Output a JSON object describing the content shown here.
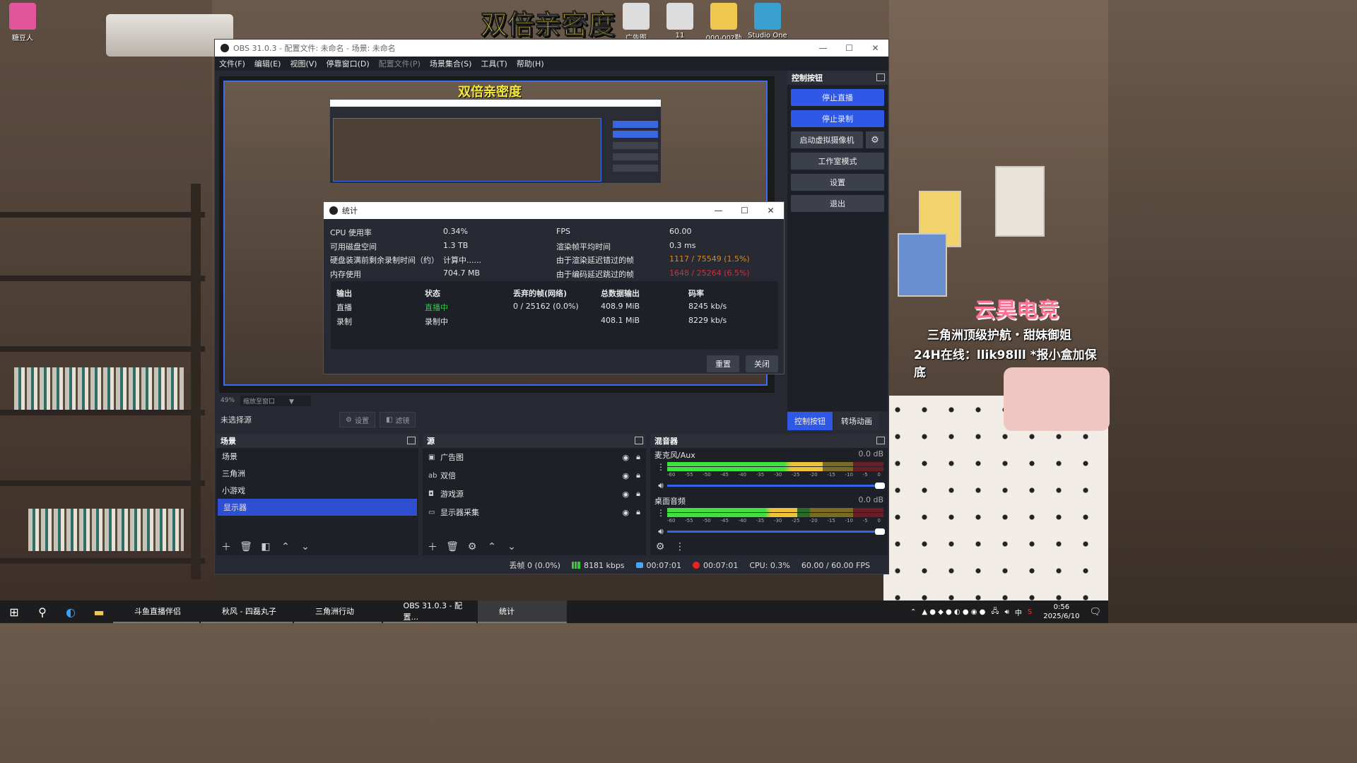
{
  "overlay": {
    "title": "双倍亲密度",
    "brand": "云昊电竞",
    "line1": "三角洲顶级护航・甜妹御姐",
    "line2": "24H在线：llik98lll *报小盒加保底"
  },
  "desktop_icons": [
    {
      "label": "糖豆人",
      "color": "#e0559c"
    },
    {
      "label": "广告图",
      "color": "#ddd"
    },
    {
      "label": "11",
      "color": "#ddd"
    },
    {
      "label": "000-00?勤能",
      "color": "#f0c850"
    },
    {
      "label": "Studio One",
      "color": "#3aa0d0"
    }
  ],
  "obs": {
    "title": "OBS 31.0.3 - 配置文件: 未命名 - 场景: 未命名",
    "menu": [
      "文件(F)",
      "编辑(E)",
      "视图(V)",
      "停靠窗口(D)",
      "配置文件(P)",
      "场景集合(S)",
      "工具(T)",
      "帮助(H)"
    ],
    "zoom": "49%",
    "zoom_mode": "缩放至窗口",
    "no_source": "未选择源",
    "settings_btn": "设置",
    "filters_btn": "滤镜",
    "controls": {
      "header": "控制按钮",
      "stop_stream": "停止直播",
      "stop_record": "停止录制",
      "virtual_cam": "启动虚拟摄像机",
      "studio_mode": "工作室模式",
      "settings": "设置",
      "exit": "退出",
      "tab_controls": "控制按钮",
      "tab_transitions": "转场动画"
    },
    "scenes": {
      "header": "场景",
      "items": [
        "场景",
        "三角洲",
        "小游戏",
        "显示器"
      ],
      "selected": 3
    },
    "sources": {
      "header": "源",
      "items": [
        {
          "name": "广告图",
          "icon": "image-icon"
        },
        {
          "name": "双倍",
          "icon": "text-icon"
        },
        {
          "name": "游戏源",
          "icon": "gamepad-icon"
        },
        {
          "name": "显示器采集",
          "icon": "monitor-icon"
        }
      ]
    },
    "mixer": {
      "header": "混音器",
      "channels": [
        {
          "name": "麦克风/Aux",
          "db": "0.0 dB",
          "level": 0.72
        },
        {
          "name": "桌面音频",
          "db": "0.0 dB",
          "level": 0.6
        }
      ],
      "scale": [
        "-60",
        "-55",
        "-50",
        "-45",
        "-40",
        "-35",
        "-30",
        "-25",
        "-20",
        "-15",
        "-10",
        "-5",
        "0"
      ]
    },
    "status": {
      "dropped": "丢帧 0 (0.0%)",
      "bitrate": "8181 kbps",
      "stream_time": "00:07:01",
      "rec_time": "00:07:01",
      "cpu": "CPU: 0.3%",
      "fps": "60.00 / 60.00 FPS"
    }
  },
  "stats": {
    "title": "统计",
    "cpu_label": "CPU 使用率",
    "cpu_value": "0.34%",
    "disk_label": "可用磁盘空间",
    "disk_value": "1.3 TB",
    "rec_time_label": "硬盘装满前剩余录制时间（约）",
    "rec_time_value": "计算中......",
    "mem_label": "内存使用",
    "mem_value": "704.7 MB",
    "fps_label": "FPS",
    "fps_value": "60.00",
    "render_label": "渲染帧平均时间",
    "render_value": "0.3 ms",
    "lag_label": "由于渲染延迟错过的帧",
    "lag_value": "1117 / 75549 (1.5%)",
    "encode_label": "由于编码延迟跳过的帧",
    "encode_value": "1648 / 25264 (6.5%)",
    "table": {
      "headers": [
        "输出",
        "状态",
        "丢弃的帧(网络)",
        "总数据输出",
        "码率"
      ],
      "rows": [
        [
          "直播",
          "直播中",
          "0 / 25162 (0.0%)",
          "408.9 MiB",
          "8245 kb/s"
        ],
        [
          "录制",
          "录制中",
          "",
          "408.1 MiB",
          "8229 kb/s"
        ]
      ]
    },
    "reset": "重置",
    "close": "关闭"
  },
  "taskbar": {
    "apps": [
      {
        "label": "斗鱼直播伴侣",
        "color": "#ff7a1a"
      },
      {
        "label": "秋风 - 四磊丸子",
        "color": "#e23"
      },
      {
        "label": "三角洲行动",
        "color": "#2c8"
      },
      {
        "label": "OBS 31.0.3 - 配置...",
        "color": "#eee"
      },
      {
        "label": "统计",
        "color": "#eee"
      }
    ],
    "ime": "中",
    "time": "0:56",
    "date": "2025/6/10"
  }
}
